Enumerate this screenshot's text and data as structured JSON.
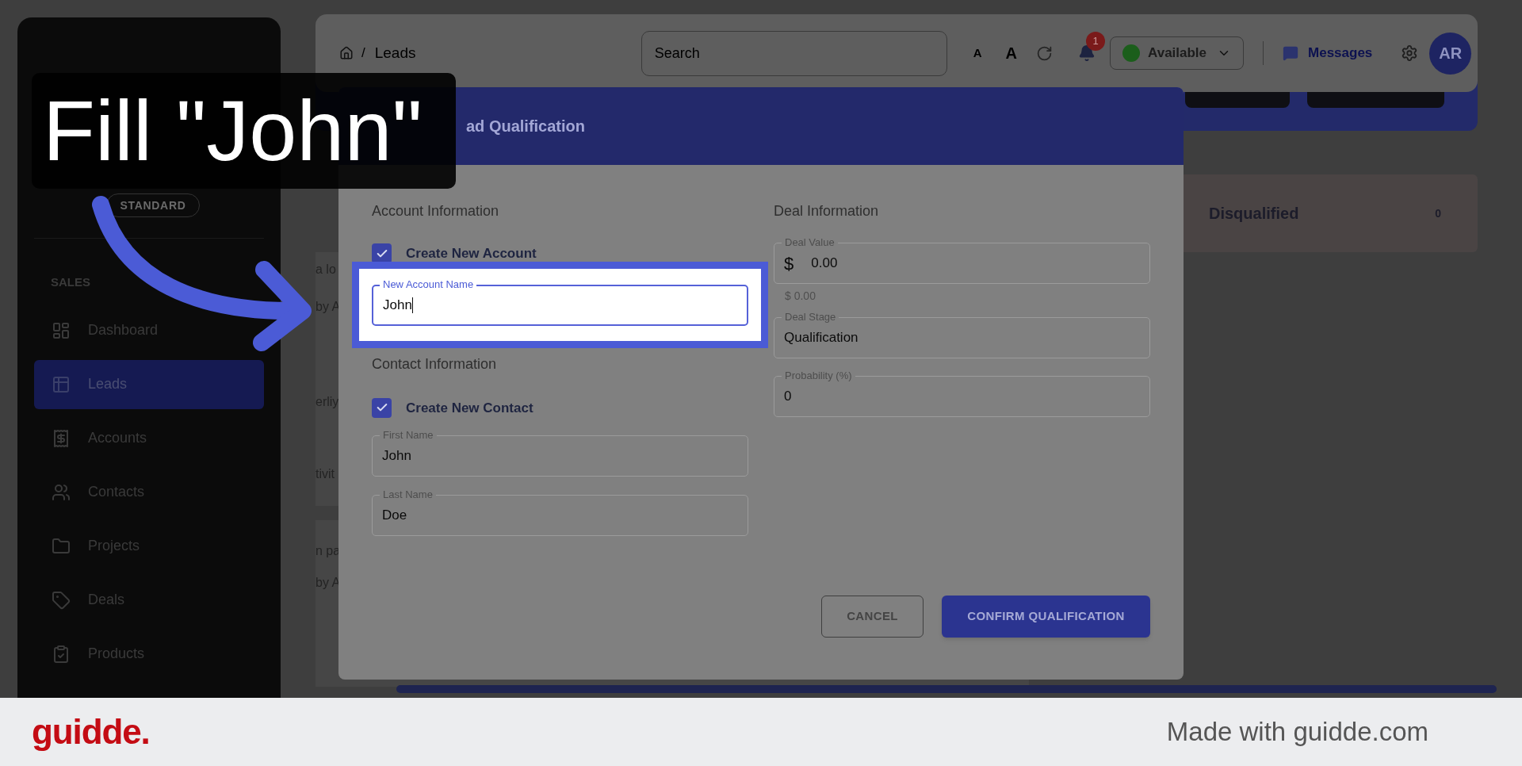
{
  "tooltip": {
    "text": "Fill \"John\""
  },
  "sidebar": {
    "badge": "STANDARD",
    "section": "SALES",
    "items": [
      {
        "label": "Dashboard",
        "selected": false
      },
      {
        "label": "Leads",
        "selected": true
      },
      {
        "label": "Accounts",
        "selected": false
      },
      {
        "label": "Contacts",
        "selected": false
      },
      {
        "label": "Projects",
        "selected": false
      },
      {
        "label": "Deals",
        "selected": false
      },
      {
        "label": "Products",
        "selected": false
      }
    ]
  },
  "header": {
    "separator": "/",
    "breadcrumb": "Leads",
    "search": {
      "placeholder": "Search"
    },
    "font_small": "A",
    "font_large": "A",
    "notifications": "1",
    "status": "Available",
    "messages": "Messages",
    "avatar": "AR"
  },
  "background": {
    "fragments": [
      "a lo",
      "by A",
      "erliy",
      "tivit",
      "n pa",
      "by A"
    ],
    "status_card": {
      "label": "Disqualified",
      "count": "0"
    }
  },
  "dialog": {
    "title": "ad Qualification",
    "account_section": "Account Information",
    "create_account": {
      "label": "Create New Account",
      "checked": true
    },
    "account_name": {
      "label": "New Account Name",
      "value": "John",
      "highlighted": true
    },
    "contact_section": "Contact Information",
    "create_contact": {
      "label": "Create New Contact",
      "checked": true
    },
    "first_name": {
      "label": "First Name",
      "value": "John"
    },
    "last_name": {
      "label": "Last Name",
      "value": "Doe"
    },
    "deal_section": "Deal Information",
    "deal_value": {
      "label": "Deal Value",
      "prefix": "$",
      "value": "0.00",
      "helper": "$ 0.00"
    },
    "deal_stage": {
      "label": "Deal Stage",
      "value": "Qualification"
    },
    "probability": {
      "label": "Probability (%)",
      "value": "0"
    },
    "buttons": [
      {
        "label": "CANCEL",
        "kind": "outlined"
      },
      {
        "label": "CONFIRM QUALIFICATION",
        "kind": "contained"
      }
    ]
  },
  "footer": {
    "logo": "guidde.",
    "credit": "Made with guidde.com"
  }
}
